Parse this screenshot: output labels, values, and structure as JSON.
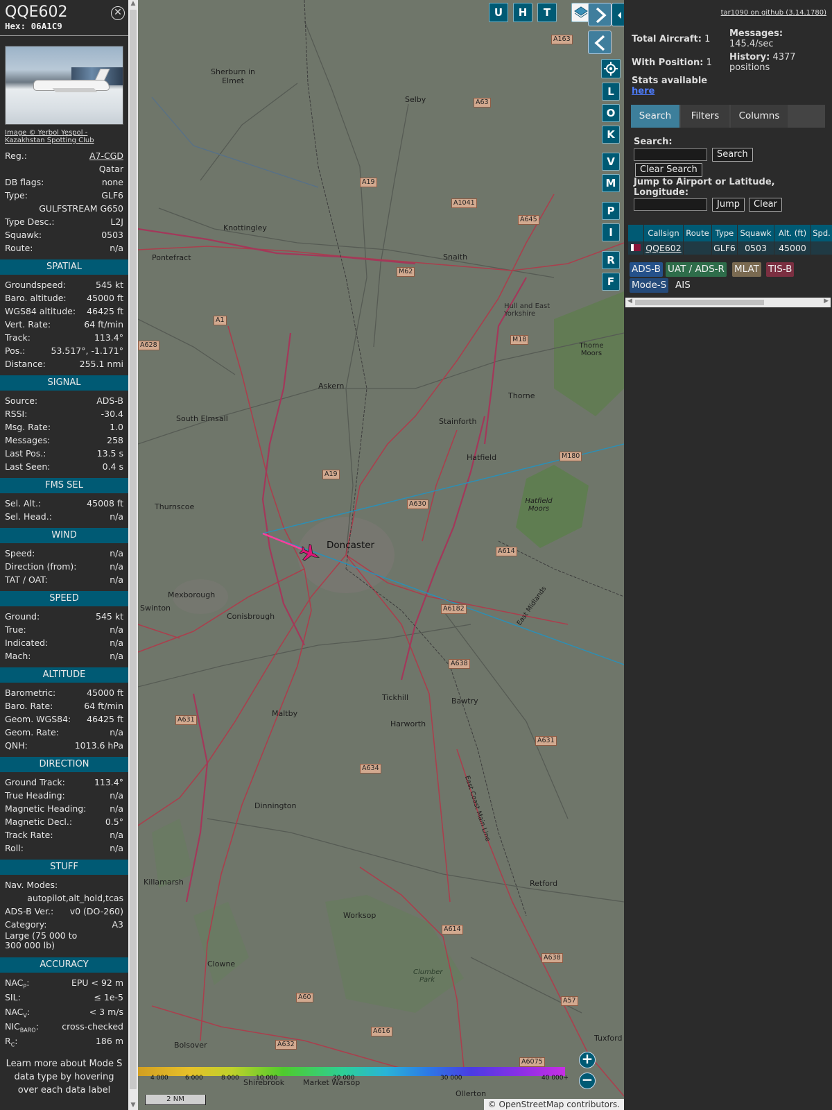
{
  "sidebar": {
    "callsign": "QQE602",
    "hex_label": "Hex:",
    "hex": "06A1C9",
    "photo_credit_1": "Image © Yerbol Yespol -",
    "photo_credit_2": "Kazakhstan Spotting Club",
    "info": [
      {
        "label": "Reg.:",
        "value": "A7-CGD",
        "link": true
      },
      {
        "label": "",
        "value": "Qatar"
      },
      {
        "label": "DB flags:",
        "value": "none"
      },
      {
        "label": "Type:",
        "value": "GLF6"
      },
      {
        "label": "",
        "value": "GULFSTREAM G650"
      },
      {
        "label": "Type Desc.:",
        "value": "L2J"
      },
      {
        "label": "Squawk:",
        "value": "0503"
      },
      {
        "label": "Route:",
        "value": "n/a"
      }
    ],
    "sections": [
      {
        "title": "SPATIAL",
        "rows": [
          {
            "label": "Groundspeed:",
            "value": "545 kt"
          },
          {
            "label": "Baro. altitude:",
            "value": "45000 ft"
          },
          {
            "label": "WGS84 altitude:",
            "value": "46425 ft"
          },
          {
            "label": "Vert. Rate:",
            "value": "64 ft/min"
          },
          {
            "label": "Track:",
            "value": "113.4°"
          },
          {
            "label": "Pos.:",
            "value": "53.517°, -1.171°"
          },
          {
            "label": "Distance:",
            "value": "255.1 nmi"
          }
        ]
      },
      {
        "title": "SIGNAL",
        "rows": [
          {
            "label": "Source:",
            "value": "ADS-B"
          },
          {
            "label": "RSSI:",
            "value": "-30.4"
          },
          {
            "label": "Msg. Rate:",
            "value": "1.0"
          },
          {
            "label": "Messages:",
            "value": "258"
          },
          {
            "label": "Last Pos.:",
            "value": "13.5 s"
          },
          {
            "label": "Last Seen:",
            "value": "0.4 s"
          }
        ]
      },
      {
        "title": "FMS SEL",
        "rows": [
          {
            "label": "Sel. Alt.:",
            "value": "45008 ft"
          },
          {
            "label": "Sel. Head.:",
            "value": "n/a"
          }
        ]
      },
      {
        "title": "WIND",
        "rows": [
          {
            "label": "Speed:",
            "value": "n/a"
          },
          {
            "label": "Direction (from):",
            "value": "n/a"
          },
          {
            "label": "TAT / OAT:",
            "value": "n/a"
          }
        ]
      },
      {
        "title": "SPEED",
        "rows": [
          {
            "label": "Ground:",
            "value": "545 kt"
          },
          {
            "label": "True:",
            "value": "n/a"
          },
          {
            "label": "Indicated:",
            "value": "n/a"
          },
          {
            "label": "Mach:",
            "value": "n/a"
          }
        ]
      },
      {
        "title": "ALTITUDE",
        "rows": [
          {
            "label": "Barometric:",
            "value": "45000 ft"
          },
          {
            "label": "Baro. Rate:",
            "value": "64 ft/min"
          },
          {
            "label": "Geom. WGS84:",
            "value": "46425 ft"
          },
          {
            "label": "Geom. Rate:",
            "value": "n/a"
          },
          {
            "label": "QNH:",
            "value": "1013.6 hPa"
          }
        ]
      },
      {
        "title": "DIRECTION",
        "rows": [
          {
            "label": "Ground Track:",
            "value": "113.4°"
          },
          {
            "label": "True Heading:",
            "value": "n/a"
          },
          {
            "label": "Magnetic Heading:",
            "value": "n/a"
          },
          {
            "label": "Magnetic Decl.:",
            "value": "0.5°"
          },
          {
            "label": "Track Rate:",
            "value": "n/a"
          },
          {
            "label": "Roll:",
            "value": "n/a"
          }
        ]
      }
    ],
    "stuff": {
      "title": "STUFF",
      "nav_modes_label": "Nav. Modes:",
      "nav_modes_value": "autopilot,alt_hold,tcas",
      "adsb_label": "ADS-B Ver.:",
      "adsb_value": "v0 (DO-260)",
      "category_label": "Category:",
      "category_value": "A3",
      "category_desc": "Large (75 000 to 300 000 lb)"
    },
    "accuracy": {
      "title": "ACCURACY",
      "nacp_label": "NAC",
      "nacp_sub": "P",
      "nacp_value": "EPU < 92 m",
      "sil_label": "SIL:",
      "sil_value": "≤ 1e-5",
      "nacv_label": "NAC",
      "nacv_sub": "V",
      "nacv_value": "< 3 m/s",
      "nic_label": "NIC",
      "nic_sub": "BARO",
      "nic_value": "cross-checked",
      "rc_label": "R",
      "rc_sub": "C",
      "rc_value": "186 m"
    },
    "learn_more": "Learn more about Mode S data type by hovering over each data label"
  },
  "map": {
    "places": [
      {
        "n": "Sherburn in Elmet"
      },
      {
        "n": "Selby"
      },
      {
        "n": "Knottingley"
      },
      {
        "n": "Pontefract"
      },
      {
        "n": "Snaith"
      },
      {
        "n": "Hull and East Yorkshire"
      },
      {
        "n": "Thorne Moors"
      },
      {
        "n": "Askern"
      },
      {
        "n": "Thorne"
      },
      {
        "n": "South Elmsall"
      },
      {
        "n": "Stainforth"
      },
      {
        "n": "Hatfield"
      },
      {
        "n": "Hatfield Moors"
      },
      {
        "n": "Thurnscoe"
      },
      {
        "n": "Doncaster"
      },
      {
        "n": "Mexborough"
      },
      {
        "n": "Swinton"
      },
      {
        "n": "Conisbrough"
      },
      {
        "n": "East Midlands"
      },
      {
        "n": "Tickhill"
      },
      {
        "n": "Bawtry"
      },
      {
        "n": "Maltby"
      },
      {
        "n": "Harworth"
      },
      {
        "n": "Dinnington"
      },
      {
        "n": "East Coast Main Line"
      },
      {
        "n": "Killamarsh"
      },
      {
        "n": "Retford"
      },
      {
        "n": "Worksop"
      },
      {
        "n": "Clowne"
      },
      {
        "n": "Clumber Park"
      },
      {
        "n": "Bolsover"
      },
      {
        "n": "Tuxford"
      },
      {
        "n": "Market Warsop"
      },
      {
        "n": "Ollerton"
      },
      {
        "n": "Shirebrook"
      }
    ],
    "roads": [
      "A163",
      "A63",
      "A19",
      "A1041",
      "A645",
      "M62",
      "A1",
      "M18",
      "A628",
      "A19",
      "A630",
      "M180",
      "A614",
      "A6182",
      "A638",
      "A631",
      "A634",
      "A614",
      "A631",
      "A638",
      "A57",
      "A60",
      "A616",
      "A632",
      "A6075"
    ],
    "hud_top": [
      "U",
      "H",
      "T"
    ],
    "hud_side": [
      "L",
      "O",
      "K",
      "V",
      "M",
      "P",
      "I",
      "R",
      "F"
    ],
    "scale": "2 NM",
    "legend_ticks": [
      "4 000",
      "6 000",
      "8 000",
      "10 000",
      "20 000",
      "30 000",
      "40 000+"
    ],
    "attribution_prefix": "© ",
    "attribution_link": "OpenStreetMap",
    "attribution_suffix": " contributors."
  },
  "right": {
    "github": "tar1090 on github (3.14.1780)",
    "total_label": "Total Aircraft:",
    "total": "1",
    "messages_label": "Messages:",
    "messages": "145.4/sec",
    "withpos_label": "With Position:",
    "withpos": "1",
    "history_label": "History:",
    "history": "4377 positions",
    "stats_label": "Stats available",
    "stats_link": "here",
    "tabs": [
      "Search",
      "Filters",
      "Columns"
    ],
    "search_label": "Search:",
    "search_btn": "Search",
    "clear_search_btn": "Clear Search",
    "jump_label": "Jump to Airport or Latitude, Longitude:",
    "jump_btn": "Jump",
    "clear_btn": "Clear",
    "table_headers": [
      "Callsign",
      "Route",
      "Type",
      "Squawk",
      "Alt. (ft)",
      "Spd."
    ],
    "table_row": {
      "callsign": "QQE602",
      "route": "",
      "type": "GLF6",
      "squawk": "0503",
      "alt": "45000"
    },
    "source_tags": [
      "ADS-B",
      "UAT / ADS-R",
      "MLAT",
      "TIS-B",
      "Mode-S",
      "AIS"
    ]
  }
}
